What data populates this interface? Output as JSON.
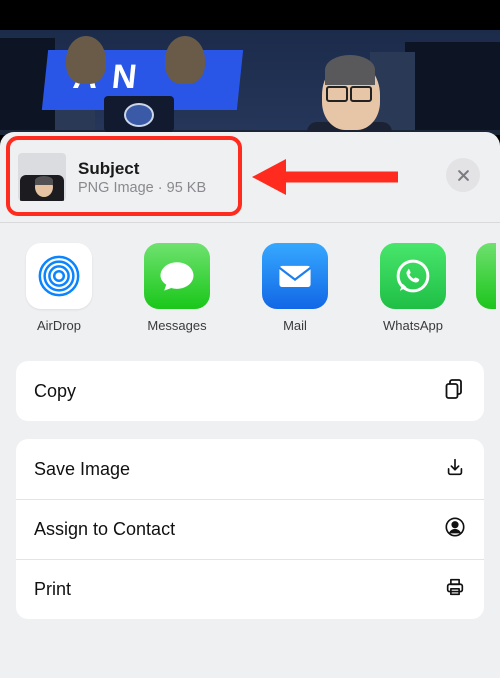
{
  "header": {
    "title": "Subject",
    "subtitle": "PNG Image · 95 KB"
  },
  "apps": [
    {
      "name": "AirDrop"
    },
    {
      "name": "Messages"
    },
    {
      "name": "Mail"
    },
    {
      "name": "WhatsApp"
    }
  ],
  "actions": {
    "copy": "Copy",
    "save_image": "Save Image",
    "assign_contact": "Assign to Contact",
    "print": "Print"
  },
  "banner_text": "A  N"
}
